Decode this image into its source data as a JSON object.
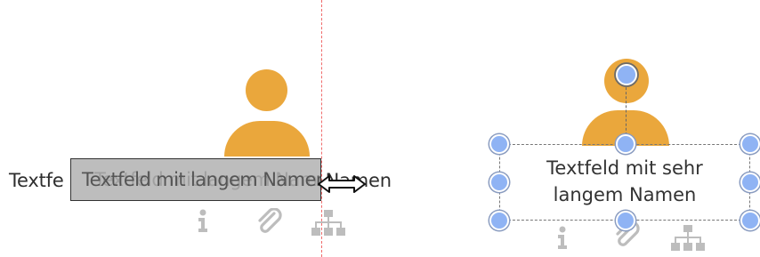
{
  "colors": {
    "person": "#eaa73c",
    "guide": "#f06a6a",
    "handle": "#8fb3f4",
    "icon": "#bdbdbd"
  },
  "left_node": {
    "label": "Textfeld mit sehr langem Namen",
    "label_visible_start": "Textfe",
    "label_visible_end": "Namen",
    "edit_text": "Textfeld mit langem Namen",
    "edit_ghost_text": "Textfeld mit langem Namen",
    "icons": [
      "info-icon",
      "attachment-icon",
      "hierarchy-icon"
    ],
    "resize_cursor": "horizontal-resize-cursor-icon"
  },
  "right_node": {
    "label_line1": "Textfeld mit sehr",
    "label_line2": "langem Namen",
    "icons": [
      "info-icon",
      "attachment-icon",
      "hierarchy-icon"
    ],
    "rotate_handle": "rotate-handle-icon"
  }
}
